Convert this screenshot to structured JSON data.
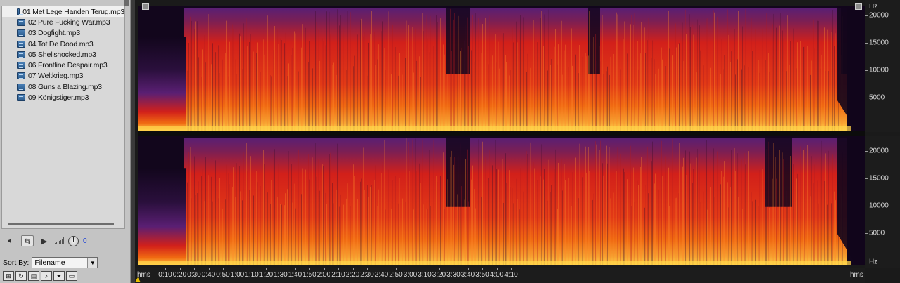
{
  "file_browser": {
    "files": [
      "01 Met Lege Handen Terug.mp3",
      "02 Pure Fucking War.mp3",
      "03 Dogfight.mp3",
      "04 Tot De Dood.mp3",
      "05 Shellshocked.mp3",
      "06 Frontline Despair.mp3",
      "07 Weltkrieg.mp3",
      "08 Guns a Blazing.mp3",
      "09 Königstiger.mp3"
    ],
    "selected_index": 0,
    "volume_value": "0",
    "sort_by_label": "Sort By:",
    "sort_by_value": "Filename"
  },
  "spectral_display": {
    "freq_unit": "Hz",
    "freq_labels": [
      "20000",
      "15000",
      "10000",
      "5000"
    ],
    "time_unit_left": "hms",
    "time_unit_right": "hms",
    "time_labels": [
      "0:10",
      "0:20",
      "0:30",
      "0:40",
      "0:50",
      "1:00",
      "1:10",
      "1:20",
      "1:30",
      "1:40",
      "1:50",
      "2:00",
      "2:10",
      "2:20",
      "2:30",
      "2:40",
      "2:50",
      "3:00",
      "3:10",
      "3:20",
      "3:30",
      "3:40",
      "3:50",
      "4:00",
      "4:10"
    ],
    "colors": {
      "background": "#1a1a1a",
      "low": "#12061c",
      "mid_purple": "#5a1f73",
      "red": "#d2201a",
      "orange": "#f06a12",
      "yellow": "#ffd24a"
    }
  }
}
